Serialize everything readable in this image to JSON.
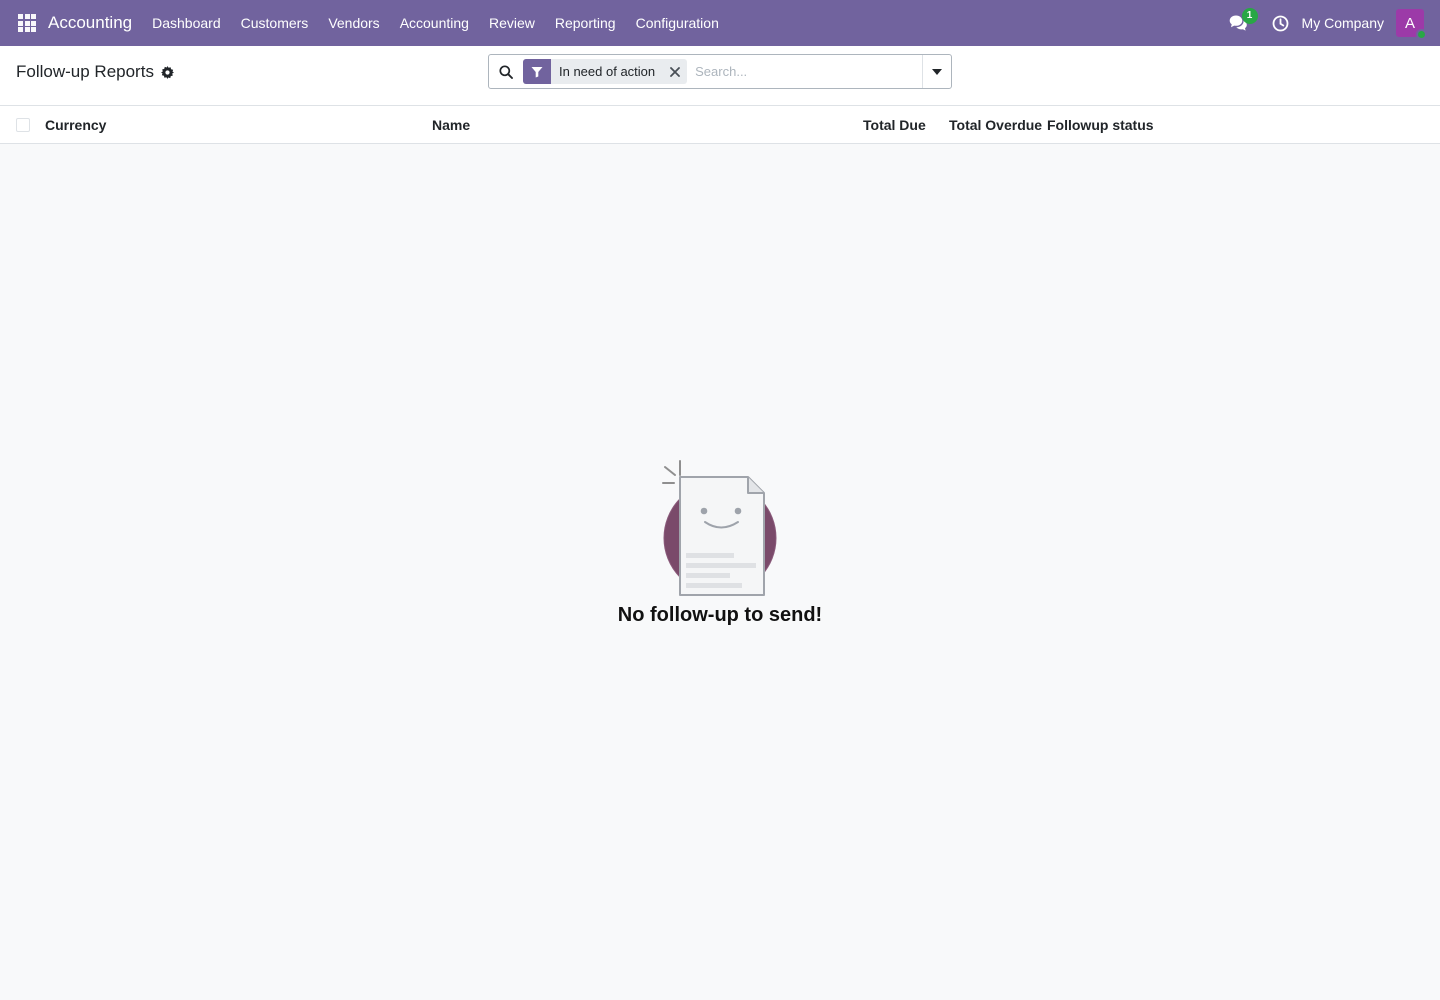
{
  "navbar": {
    "app_name": "Accounting",
    "menu": [
      "Dashboard",
      "Customers",
      "Vendors",
      "Accounting",
      "Review",
      "Reporting",
      "Configuration"
    ],
    "chat_count": "1",
    "company": "My Company",
    "avatar_letter": "A",
    "bg_color": "#71639e"
  },
  "control": {
    "title": "Follow-up Reports",
    "search": {
      "facet_label": "In need of action",
      "placeholder": "Search..."
    }
  },
  "table": {
    "columns": [
      "Currency",
      "Name",
      "Total Due",
      "Total Overdue",
      "Followup status"
    ]
  },
  "empty": {
    "message": "No follow-up to send!"
  }
}
